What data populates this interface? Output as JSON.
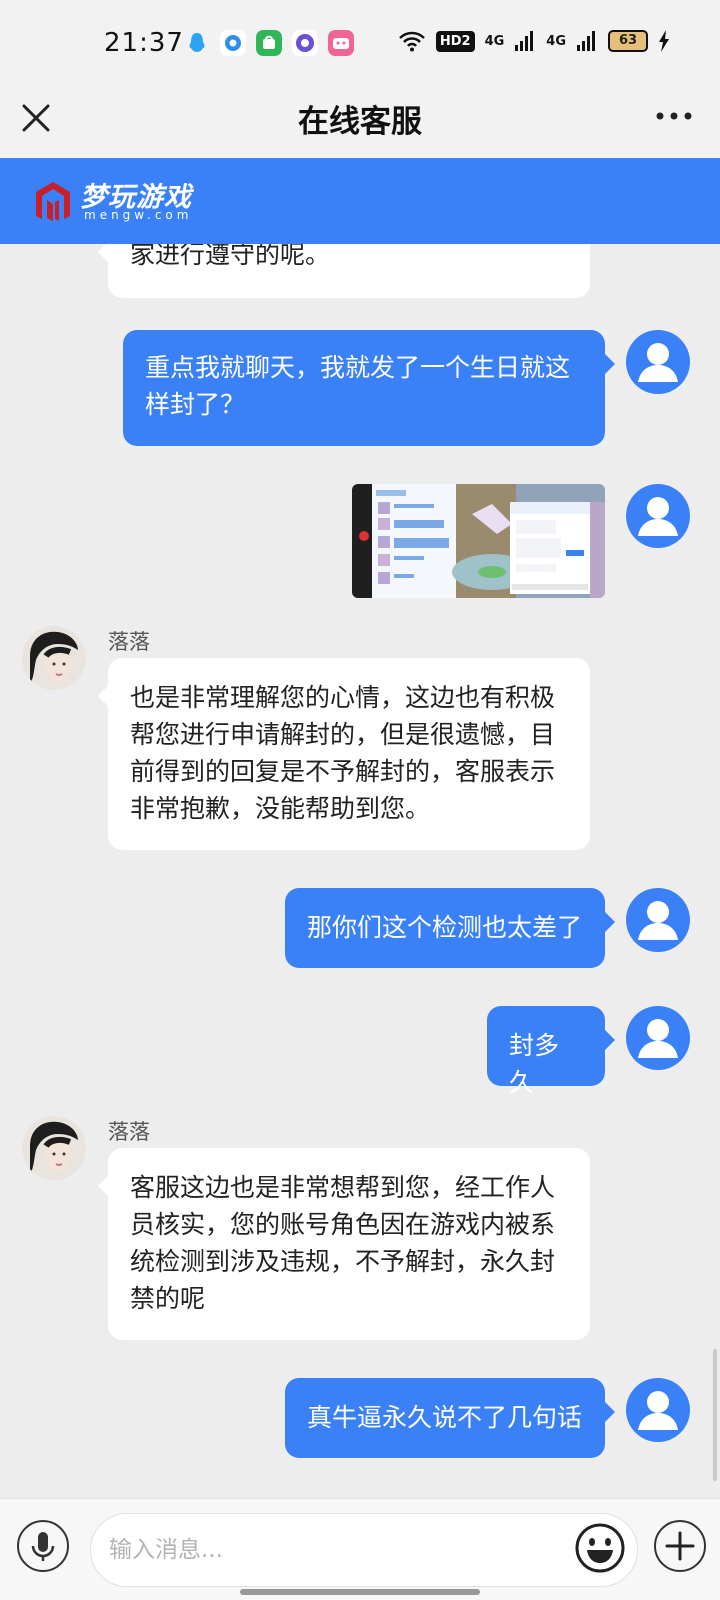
{
  "status_bar": {
    "time": "21:37",
    "hd_label": "HD2",
    "signal_1": "4G",
    "signal_2": "4G",
    "battery": "63"
  },
  "header": {
    "title": "在线客服"
  },
  "brand": {
    "name": "梦玩游戏",
    "subtitle": "mengw.com"
  },
  "messages": [
    {
      "side": "left",
      "text": "家进行遵守的呢。"
    },
    {
      "side": "right",
      "text": "重点我就聊天，我就发了一个生日就这样封了？"
    },
    {
      "side": "right",
      "type": "image",
      "icon": "screenshot-image"
    },
    {
      "side": "left",
      "sender": "落落",
      "text": "也是非常理解您的心情，这边也有积极帮您进行申请解封的，但是很遗憾，目前得到的回复是不予解封的，客服表示非常抱歉，没能帮助到您。"
    },
    {
      "side": "right",
      "text": "那你们这个检测也太差了"
    },
    {
      "side": "right",
      "text": "封多久"
    },
    {
      "side": "left",
      "sender": "落落",
      "text": "客服这边也是非常想帮到您，经工作人员核实，您的账号角色因在游戏内被系统检测到涉及违规，不予解封，永久封禁的呢"
    },
    {
      "side": "right",
      "text": "真牛逼永久说不了几句话"
    }
  ],
  "input": {
    "placeholder": "输入消息..."
  },
  "colors": {
    "accent": "#3a80f7",
    "background": "#ededed",
    "bubble_left": "#ffffff"
  }
}
